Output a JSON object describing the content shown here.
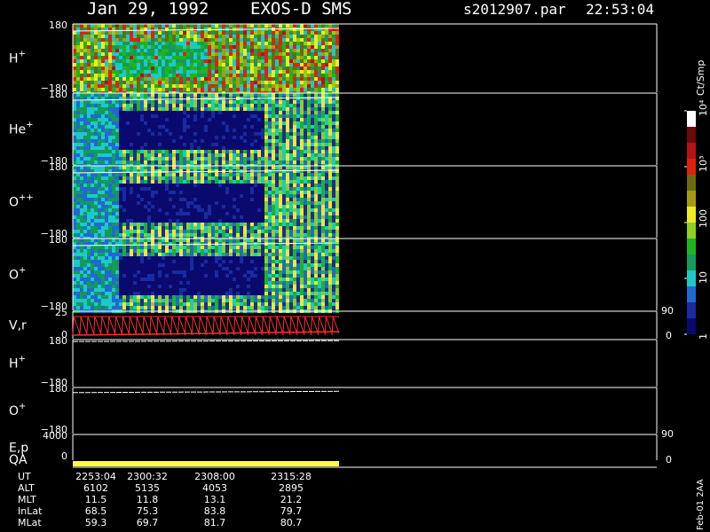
{
  "header": {
    "date": "Jan 29, 1992",
    "instrument": "EXOS-D SMS",
    "file": "s2012907.par",
    "time": "22:53:04"
  },
  "colors": {
    "background": "#000000",
    "axis": "#ffffff",
    "velocity_trace": "#ff3030",
    "qa_bar": "#ffff40"
  },
  "colorbar": {
    "unit": "Ct/Smp",
    "tick_labels": [
      "1",
      "10",
      "100",
      "10³",
      "10⁴"
    ],
    "scale": "log",
    "range": [
      1,
      10000
    ]
  },
  "right_axes": {
    "vr_top": "90",
    "vr_bottom": "0",
    "ep_top": "90",
    "ep_bottom": "0"
  },
  "side_label": "Feb-01 2AA",
  "chart_data": [
    {
      "type": "heatmap",
      "panel": "H+",
      "label": "H",
      "superscript": "+",
      "ylim": [
        -180,
        180
      ],
      "ytick_top": "180",
      "ytick_bottom": "−180",
      "xlim": [
        "2253:04",
        "2318:00"
      ],
      "data_end": "2303:30",
      "dominant_level": "high",
      "seed": 1
    },
    {
      "type": "heatmap",
      "panel": "He+",
      "label": "He",
      "superscript": "+",
      "ylim": [
        -180,
        180
      ],
      "ytick_top": "180",
      "ytick_bottom": "−180",
      "xlim": [
        "2253:04",
        "2318:00"
      ],
      "data_end": "2303:30",
      "dominant_level": "low",
      "seed": 2
    },
    {
      "type": "heatmap",
      "panel": "O++",
      "label": "O",
      "superscript": "++",
      "ylim": [
        -180,
        180
      ],
      "ytick_top": "180",
      "ytick_bottom": "−180",
      "xlim": [
        "2253:04",
        "2318:00"
      ],
      "data_end": "2303:30",
      "dominant_level": "low",
      "seed": 3
    },
    {
      "type": "heatmap",
      "panel": "O+",
      "label": "O",
      "superscript": "+",
      "ylim": [
        -180,
        180
      ],
      "ytick_top": "180",
      "ytick_bottom": "−180",
      "xlim": [
        "2253:04",
        "2318:00"
      ],
      "data_end": "2303:30",
      "dominant_level": "low",
      "seed": 4
    },
    {
      "type": "line",
      "panel": "V,r",
      "label": "V,r",
      "ytick_top": "25",
      "ytick_bottom": "0",
      "ylim": [
        0,
        25
      ],
      "color": "#ff3030",
      "sawtooth_cycles": 38
    },
    {
      "type": "line",
      "panel": "H+ phase",
      "label": "H",
      "superscript": "+",
      "ylim": [
        -180,
        180
      ],
      "ytick_top": "180",
      "ytick_bottom": "−180",
      "x": [
        "2253:04",
        "2303:30"
      ],
      "y": [
        165,
        172
      ]
    },
    {
      "type": "line",
      "panel": "O+ phase",
      "label": "O",
      "superscript": "+",
      "ylim": [
        -180,
        180
      ],
      "ytick_top": "180",
      "ytick_bottom": "−180",
      "x": [
        "2253:04",
        "2303:30"
      ],
      "y": [
        140,
        150
      ]
    },
    {
      "type": "line",
      "panel": "E,p",
      "label": "E,p",
      "ytick_top": "4000",
      "ytick_bottom": "0",
      "ylim": [
        0,
        4000
      ]
    },
    {
      "type": "bar",
      "panel": "QA",
      "label": "QA",
      "color": "#ffff40"
    }
  ],
  "ephemeris": {
    "rows": [
      {
        "label": "UT",
        "values": [
          "2253:04",
          "2300:32",
          "2308:00",
          "2315:28"
        ]
      },
      {
        "label": "ALT",
        "values": [
          "6102",
          "5135",
          "4053",
          "2895"
        ]
      },
      {
        "label": "MLT",
        "values": [
          "11.5",
          "11.8",
          "13.1",
          "21.2"
        ]
      },
      {
        "label": "InLat",
        "values": [
          "68.5",
          "75.3",
          "83.8",
          "79.7"
        ]
      },
      {
        "label": "MLat",
        "values": [
          "59.3",
          "69.7",
          "81.7",
          "80.7"
        ]
      }
    ]
  }
}
